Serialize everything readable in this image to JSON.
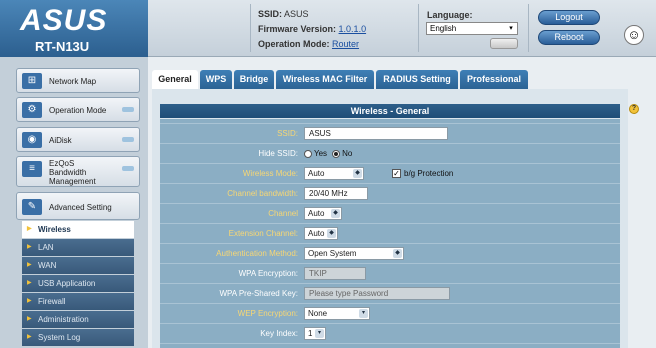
{
  "brand": {
    "logo": "ASUS",
    "model": "RT-N13U"
  },
  "header": {
    "ssid_label": "SSID:",
    "ssid_value": "ASUS",
    "firmware_label": "Firmware Version:",
    "firmware_value": "1.0.1.0",
    "opmode_label": "Operation Mode:",
    "opmode_value": "Router",
    "language_label": "Language:",
    "language_value": "English",
    "logout": "Logout",
    "reboot": "Reboot"
  },
  "sidebar": {
    "main": [
      {
        "label": "Network Map",
        "icon": "network-map-icon"
      },
      {
        "label": "Operation Mode",
        "icon": "operation-mode-icon"
      },
      {
        "label": "AiDisk",
        "icon": "aidisk-icon"
      },
      {
        "label": "EzQoS Bandwidth Management",
        "icon": "qos-icon"
      },
      {
        "label": "Advanced Setting",
        "icon": "advanced-setting-icon"
      }
    ],
    "sub": [
      "Wireless",
      "LAN",
      "WAN",
      "USB Application",
      "Firewall",
      "Administration",
      "System Log"
    ],
    "active_sub": "Wireless"
  },
  "tabs": [
    "General",
    "WPS",
    "Bridge",
    "Wireless MAC Filter",
    "RADIUS Setting",
    "Professional"
  ],
  "active_tab": "General",
  "content": {
    "title": "Wireless - General",
    "fields": {
      "ssid": {
        "label": "SSID:",
        "value": "ASUS"
      },
      "hide_ssid": {
        "label": "Hide SSID:",
        "yes": "Yes",
        "no": "No",
        "selected": "No"
      },
      "mode": {
        "label": "Wireless Mode:",
        "value": "Auto",
        "checkbox": "b/g Protection",
        "checked": true
      },
      "bandwidth": {
        "label": "Channel bandwidth:",
        "value": "20/40 MHz"
      },
      "channel": {
        "label": "Channel",
        "value": "Auto"
      },
      "ext_channel": {
        "label": "Extension Channel:",
        "value": "Auto"
      },
      "auth": {
        "label": "Authentication Method:",
        "value": "Open System"
      },
      "wpa_enc": {
        "label": "WPA Encryption:",
        "value": "TKIP"
      },
      "wpa_key": {
        "label": "WPA Pre-Shared Key:",
        "placeholder": "Please type Password"
      },
      "wep": {
        "label": "WEP Encryption:",
        "value": "None"
      },
      "key_index": {
        "label": "Key Index:",
        "value": "1"
      }
    }
  },
  "colors": {
    "accent": "#2c6394",
    "label_yellow": "#f7d774",
    "form_bg": "#8baec4"
  }
}
